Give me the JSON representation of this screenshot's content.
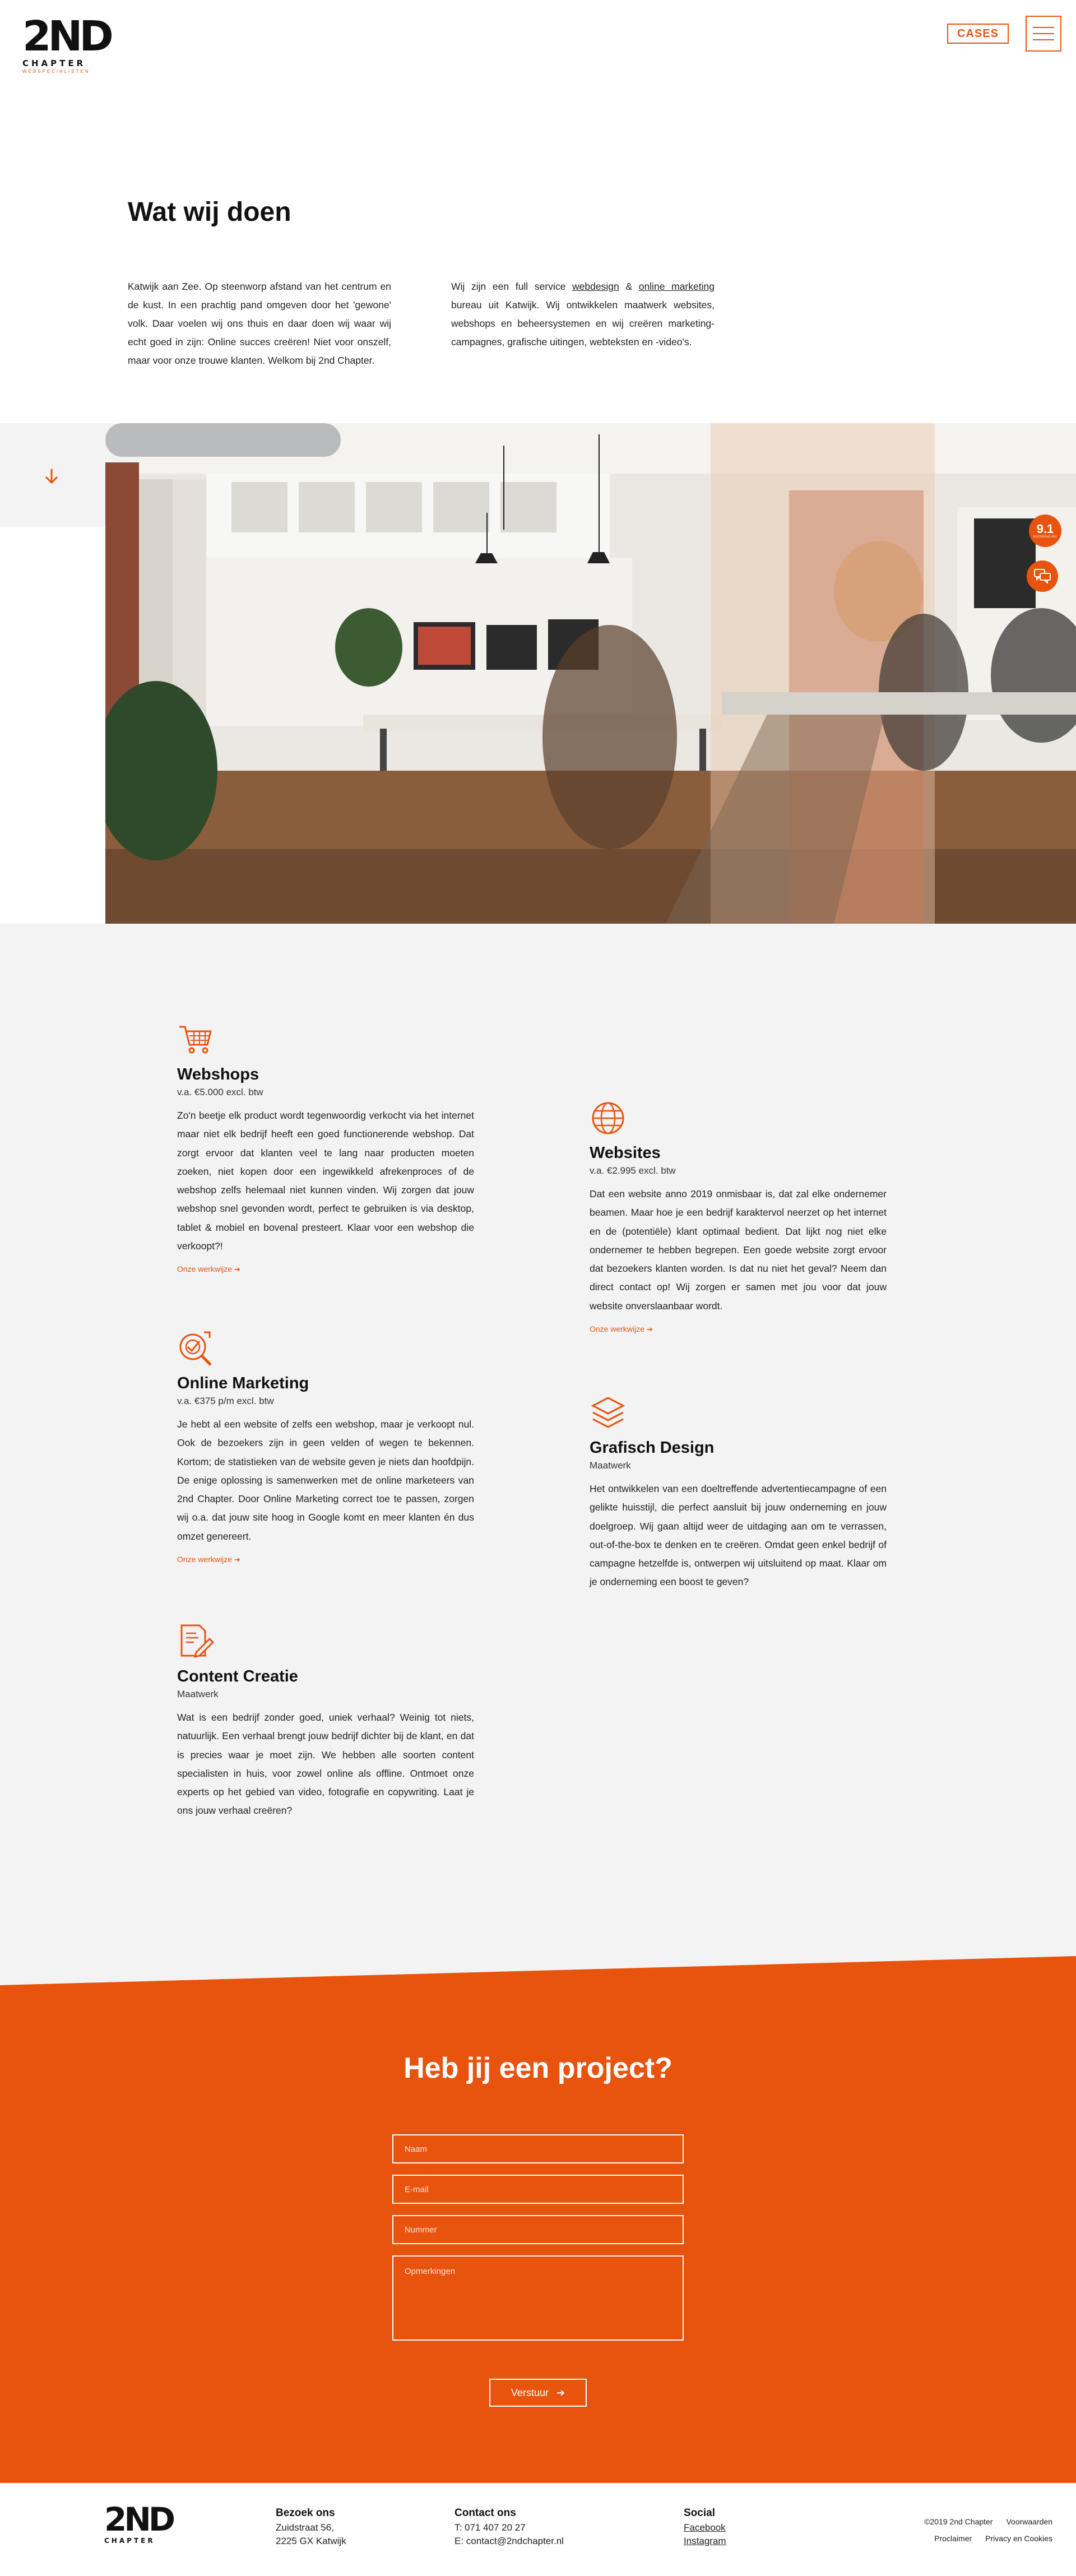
{
  "header": {
    "logo_main": "2ND",
    "logo_sub": "CHAPTER",
    "logo_tag": "WEBSPECIALISTEN",
    "cases_label": "CASES"
  },
  "intro": {
    "title": "Wat wij doen",
    "left_text": "Katwijk aan Zee. Op steenworp afstand van het centrum en de kust. In een prachtig pand omgeven door het 'gewone' volk. Daar voelen wij ons thuis en daar doen wij waar wij echt goed in zijn: Online succes creëren! Niet voor onszelf, maar voor onze trouwe klanten. Welkom bij 2nd Chapter.",
    "right_pre": "Wij zijn een full service ",
    "right_link1": "webdesign",
    "right_mid": " & ",
    "right_link2": "online marketing",
    "right_post": " bureau uit Katwijk. Wij ontwikkelen maatwerk websites, webshops en beheersystemen en wij creëren marketing-campagnes, grafische uitingen, webteksten en -video's."
  },
  "rating": {
    "score": "9.1",
    "label": "BEOORDELING"
  },
  "services": [
    {
      "icon": "cart-icon",
      "title": "Webshops",
      "price": "v.a. €5.000 excl. btw",
      "body": "Zo'n beetje elk product wordt tegenwoordig verkocht via het internet maar niet elk bedrijf heeft een goed functionerende webshop. Dat zorgt ervoor dat klanten veel te lang naar producten moeten zoeken, niet kopen door een ingewikkeld afrekenproces of de webshop zelfs helemaal niet kunnen vinden. Wij zorgen dat jouw webshop snel gevonden wordt, perfect te gebruiken is via desktop, tablet & mobiel en bovenal presteert. Klaar voor een webshop die verkoopt?!",
      "link": "Onze werkwijze"
    },
    {
      "icon": "globe-icon",
      "title": "Websites",
      "price": "v.a. €2.995 excl. btw",
      "body": "Dat een website anno 2019 onmisbaar is, dat zal elke ondernemer beamen. Maar hoe je een bedrijf karaktervol neerzet op het internet en de (potentiële) klant optimaal bedient. Dat lijkt nog niet elke ondernemer te hebben begrepen. Een goede website zorgt ervoor dat bezoekers klanten worden. Is dat nu niet het geval? Neem dan direct contact op! Wij zorgen er samen met jou voor dat jouw website onverslaanbaar wordt.",
      "link": "Onze werkwijze"
    },
    {
      "icon": "target-icon",
      "title": "Online Marketing",
      "price": "v.a. €375 p/m excl. btw",
      "body": "Je hebt al een website of zelfs een webshop, maar je verkoopt nul. Ook de bezoekers zijn in geen velden of wegen te bekennen. Kortom; de statistieken van de website geven je niets dan hoofdpijn. De enige oplossing is samenwerken met de online marketeers van 2nd Chapter. Door Online Marketing correct toe te passen, zorgen wij o.a. dat jouw site hoog in Google komt en meer klanten én dus omzet genereert.",
      "link": "Onze werkwijze"
    },
    {
      "icon": "layers-icon",
      "title": "Grafisch Design",
      "price": "Maatwerk",
      "body": "Het ontwikkelen van een doeltreffende advertentiecampagne of een gelikte huisstijl, die perfect aansluit bij jouw onderneming en jouw doelgroep. Wij gaan altijd weer de uitdaging aan om te verrassen, out-of-the-box te denken en te creëren. Omdat geen enkel bedrijf of campagne hetzelfde is, ontwerpen wij uitsluitend op maat. Klaar om je onderneming een boost te geven?",
      "link": ""
    },
    {
      "icon": "document-pen-icon",
      "title": "Content Creatie",
      "price": "Maatwerk",
      "body": "Wat is een bedrijf zonder goed, uniek verhaal? Weinig tot niets, natuurlijk. Een verhaal brengt jouw bedrijf dichter bij de klant, en dat is precies waar je moet zijn. We hebben alle soorten content specialisten in huis, voor zowel online als offline. Ontmoet onze experts op het gebied van video, fotografie en copywriting. Laat je ons jouw verhaal creëren?",
      "link": ""
    }
  ],
  "contact": {
    "title": "Heb jij een project?",
    "name_placeholder": "Naam",
    "email_placeholder": "E-mail",
    "phone_placeholder": "Nummer",
    "remarks_placeholder": "Opmerkingen",
    "submit_label": "Verstuur"
  },
  "footer": {
    "visit_title": "Bezoek ons",
    "address_line1": "Zuidstraat 56,",
    "address_line2": "2225 GX Katwijk",
    "contact_title": "Contact ons",
    "phone": "T:  071 407 20 27",
    "email": "E:  contact@2ndchapter.nl",
    "social_title": "Social",
    "facebook": "Facebook",
    "instagram": "Instagram",
    "copyright": "©2019 2nd Chapter",
    "terms": "Voorwaarden",
    "disclaimer": "Proclaimer",
    "privacy": "Privacy en Cookies"
  },
  "colors": {
    "accent": "#e8530e",
    "section_gray": "#f3f3f3"
  }
}
